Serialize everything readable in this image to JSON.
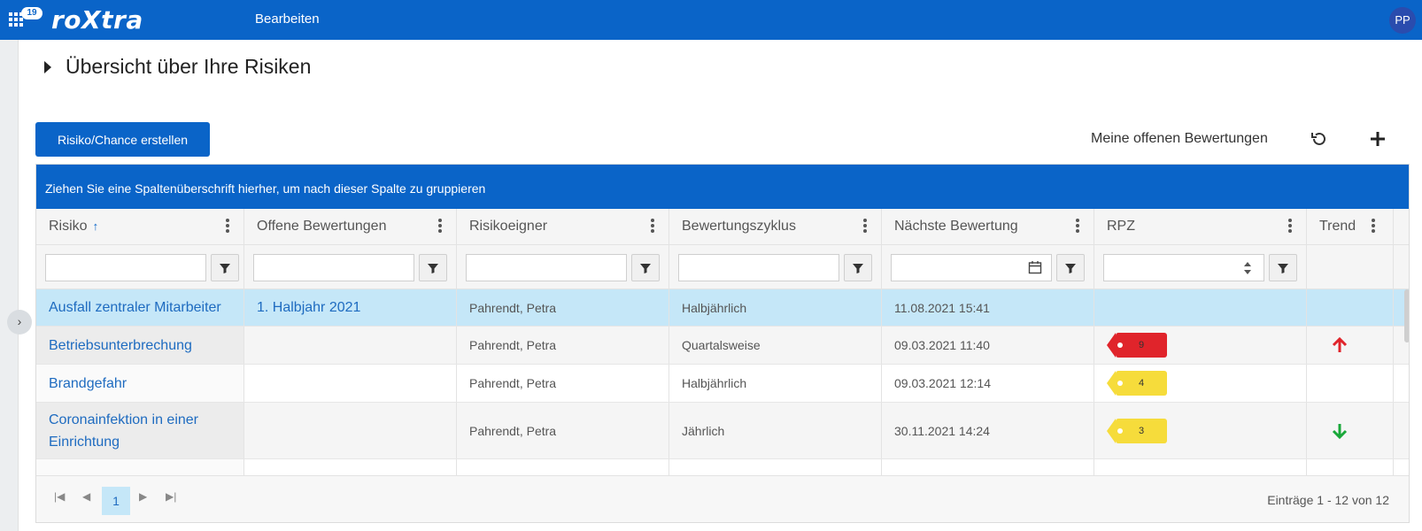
{
  "topbar": {
    "badge_count": "19",
    "logo": "roXtra",
    "nav_edit": "Bearbeiten",
    "avatar_initials": "PP"
  },
  "page": {
    "title": "Übersicht über Ihre Risiken"
  },
  "toolbar": {
    "create_label": "Risiko/Chance erstellen",
    "open_ratings_label": "Meine offenen Bewertungen"
  },
  "grid": {
    "group_hint": "Ziehen Sie eine Spaltenüberschrift hierher, um nach dieser Spalte zu gruppieren",
    "columns": [
      "Risiko",
      "Offene Bewertungen",
      "Risikoeigner",
      "Bewertungszyklus",
      "Nächste Bewertung",
      "RPZ",
      "Trend"
    ],
    "sort_indicator": "↑",
    "rows": [
      {
        "risk": "Ausfall zentraler Mitarbeiter",
        "open": "1. Halbjahr 2021",
        "owner": "Pahrendt, Petra",
        "cycle": "Halbjährlich",
        "next": "11.08.2021 15:41",
        "rpz": "",
        "trend": ""
      },
      {
        "risk": "Betriebsunterbrechung",
        "open": "",
        "owner": "Pahrendt, Petra",
        "cycle": "Quartalsweise",
        "next": "09.03.2021 11:40",
        "rpz": "9",
        "trend": "up"
      },
      {
        "risk": "Brandgefahr",
        "open": "",
        "owner": "Pahrendt, Petra",
        "cycle": "Halbjährlich",
        "next": "09.03.2021 12:14",
        "rpz": "4",
        "trend": ""
      },
      {
        "risk": "Coronainfektion in einer Einrichtung",
        "open": "",
        "owner": "Pahrendt, Petra",
        "cycle": "Jährlich",
        "next": "30.11.2021 14:24",
        "rpz": "3",
        "trend": "down"
      }
    ],
    "colors": {
      "rpz_high": "#e0242b",
      "rpz_medium": "#f6dc3b",
      "trend_up": "#e0242b",
      "trend_down": "#1aa83a",
      "accent": "#0a64c8"
    }
  },
  "pager": {
    "current_page": "1",
    "entries_label": "Einträge 1 - 12 von 12"
  }
}
